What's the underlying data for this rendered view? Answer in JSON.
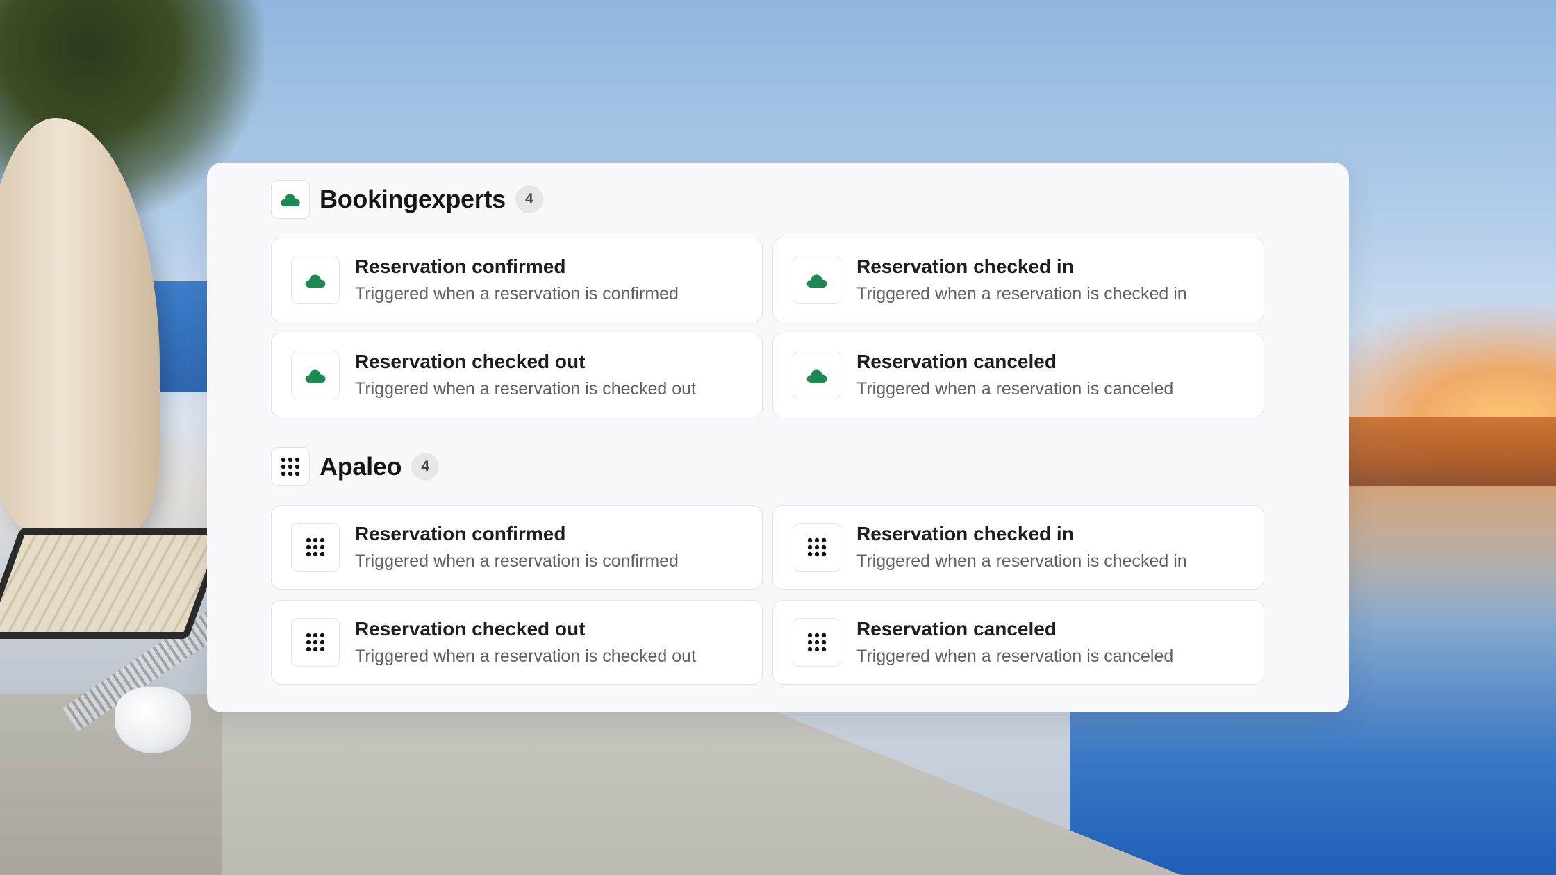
{
  "colors": {
    "bookingexperts_green": "#1a8a52",
    "apaleo_black": "#111111"
  },
  "groups": [
    {
      "name": "Bookingexperts",
      "count": "4",
      "icon": "cloud-icon",
      "items": [
        {
          "title": "Reservation confirmed",
          "description": "Triggered when a reservation is confirmed"
        },
        {
          "title": "Reservation checked in",
          "description": "Triggered when a reservation is checked in"
        },
        {
          "title": "Reservation checked out",
          "description": "Triggered when a reservation is checked out"
        },
        {
          "title": "Reservation canceled",
          "description": "Triggered when a reservation is canceled"
        }
      ]
    },
    {
      "name": "Apaleo",
      "count": "4",
      "icon": "dot-grid-icon",
      "items": [
        {
          "title": "Reservation confirmed",
          "description": "Triggered when a reservation is confirmed"
        },
        {
          "title": "Reservation checked in",
          "description": "Triggered when a reservation is checked in"
        },
        {
          "title": "Reservation checked out",
          "description": "Triggered when a reservation is checked out"
        },
        {
          "title": "Reservation canceled",
          "description": "Triggered when a reservation is canceled"
        }
      ]
    }
  ]
}
